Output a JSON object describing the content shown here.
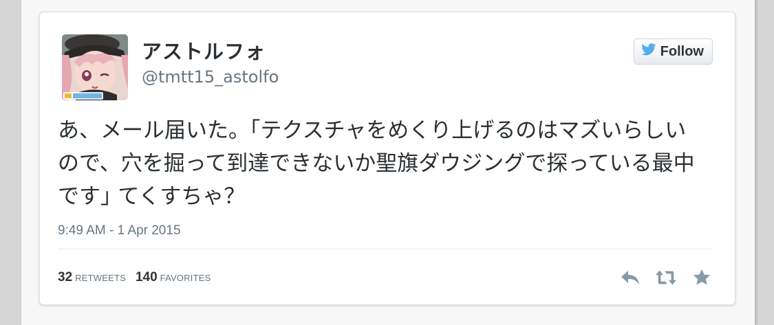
{
  "tweet": {
    "author": {
      "display_name": "アストルフォ",
      "screen_name": "@tmtt15_astolfo",
      "avatar": "avatar-illustration"
    },
    "follow_button": {
      "label": "Follow",
      "icon": "twitter-bird-icon"
    },
    "text": "あ、メール届いた。｢テクスチャをめくり上げるのはマズいらしいので、穴を掘って到達できないか聖旗ダウジングで探っている最中です｣ てくすちゃ？",
    "timestamp": "9:49 AM - 1 Apr 2015",
    "stats": {
      "retweets_count": "32",
      "retweets_label": "RETWEETS",
      "favorites_count": "140",
      "favorites_label": "FAVORITES"
    },
    "actions": [
      "reply-icon",
      "retweet-icon",
      "favorite-icon"
    ]
  },
  "colors": {
    "twitter_blue": "#55acee",
    "icon_gray": "#8899a6",
    "text_dark": "#292f33",
    "text_muted": "#66757f"
  }
}
